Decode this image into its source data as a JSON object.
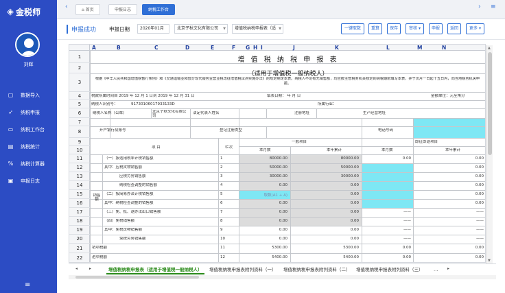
{
  "app": {
    "logo": "金税师",
    "user_name": "刘辉"
  },
  "sidebar": {
    "items": [
      {
        "label": "数据导入",
        "icon": "document-icon"
      },
      {
        "label": "纳税申报",
        "icon": "send-icon"
      },
      {
        "label": "纳税工作台",
        "icon": "monitor-icon"
      },
      {
        "label": "纳税统计",
        "icon": "report-icon"
      },
      {
        "label": "纳税计算器",
        "icon": "percent-icon"
      },
      {
        "label": "申报日志",
        "icon": "log-icon"
      }
    ],
    "menu_icon": "≡"
  },
  "tabs": [
    {
      "label": "首页",
      "active": false
    },
    {
      "label": "申报日志",
      "active": false
    },
    {
      "label": "纳税工作台",
      "active": true
    }
  ],
  "toolbar": {
    "status": "申报成功",
    "period_label": "申报日期",
    "period_value": "2020年01月",
    "company": "北京子秋文化有限公司",
    "form_type": "增值税纳税申报表（适",
    "buttons": [
      "一键取数",
      "重算",
      "保存",
      "审核",
      "申报",
      "返回",
      "更多"
    ]
  },
  "sheet": {
    "columns": [
      "A",
      "B",
      "C",
      "D",
      "E",
      "F",
      "G",
      "H",
      "I",
      "J",
      "K",
      "L",
      "M",
      "N"
    ],
    "rows": [
      "1",
      "2",
      "3",
      "4",
      "5",
      "6",
      "7",
      "8",
      "9",
      "10",
      "11",
      "12",
      "13",
      "14",
      "15",
      "16",
      "17",
      "18",
      "19",
      "20",
      "21",
      "22"
    ],
    "title": "增 值 税 纳 税 申 报 表",
    "subtitle": "（适用于增值税一般纳税人）",
    "note": "根据《中华人民共和国增值税暂行条例》和《交通运输业和部分现代服务业营业税改征增值税试点实施办法》的规定制定本表。纳税人不论有无销售额，均应按主管税务机关核定的纳税期限填写本表，并于次月一日起十五日内，向当地税务机关申报。",
    "period_line": "税款所属时间自  2019  年  12  月  1  日到  2019  年  12  月  31  日",
    "fill_date": "填表日期：    年    月    日",
    "unit": "金额单位：元至角分",
    "taxpayer_id_label": "纳税人识别号：",
    "taxpayer_id": "91730106017933133D",
    "industry_label": "所属行业：",
    "taxpayer_name_label": "纳税人名称（公章）",
    "taxpayer_name": "北京子秋文化有限公司",
    "legal_rep_label": "法定代表人姓名",
    "reg_addr_label": "注册地址",
    "biz_addr_label": "生产经营地址",
    "bank_label": "开户银行及账号",
    "reg_type_label": "登记注册类型",
    "phone_label": "电话号码",
    "item_header": "项    目",
    "line_header": "栏次",
    "general_header": "一般项目",
    "immediate_header": "即征即退项目",
    "this_month": "本月数",
    "year_total": "本年累计",
    "sales_group": "销售额",
    "line_items": [
      {
        "label": "（一）按适用税率计税销售额",
        "no": "1",
        "gm": "80000.00",
        "gy": "80000.00",
        "im": "0.00",
        "iy": "0.00"
      },
      {
        "label": "其中：应税货物销售额",
        "no": "2",
        "gm": "50000.00",
        "gy": "50000.00",
        "im": "",
        "iy": "0.00"
      },
      {
        "label": "应税劳务销售额",
        "no": "3",
        "gm": "30000.00",
        "gy": "30000.00",
        "im": "",
        "iy": "0.00"
      },
      {
        "label": "纳税检查调整的销售额",
        "no": "4",
        "gm": "0.00",
        "gy": "0.00",
        "im": "",
        "iy": "0.00"
      },
      {
        "label": "（二）按简易办法计税销售额",
        "no": "5",
        "gm": "取数(A1 + A)",
        "gy": "0.00",
        "im": "",
        "iy": "0.00"
      },
      {
        "label": "其中：纳税检查调整的销售额",
        "no": "6",
        "gm": "0.00",
        "gy": "0.00",
        "im": "",
        "iy": "0.00"
      },
      {
        "label": "（三）免、抵、退办法出口销售额",
        "no": "7",
        "gm": "0.00",
        "gy": "0.00",
        "im": "——",
        "iy": "——"
      },
      {
        "label": "（四）免税销售额",
        "no": "8",
        "gm": "0.00",
        "gy": "0.00",
        "im": "——",
        "iy": "——"
      },
      {
        "label": "其中：免税货物销售额",
        "no": "9",
        "gm": "0.00",
        "gy": "0.00",
        "im": "——",
        "iy": "——"
      },
      {
        "label": "免税劳务销售额",
        "no": "10",
        "gm": "0.00",
        "gy": "0.00",
        "im": "——",
        "iy": "——"
      },
      {
        "label": "销项税额",
        "no": "11",
        "gm": "5300.00",
        "gy": "5300.00",
        "im": "0.00",
        "iy": "0.00"
      },
      {
        "label": "进项税额",
        "no": "12",
        "gm": "5400.00",
        "gy": "5400.00",
        "im": "0.00",
        "iy": "0.00"
      }
    ]
  },
  "sheet_tabs": [
    {
      "label": "增值税纳税申报表（适用于增值税一般纳税人）",
      "active": true
    },
    {
      "label": "增值税纳税申报表附列资料（一）",
      "active": false
    },
    {
      "label": "增值税纳税申报表附列资料（二）",
      "active": false
    },
    {
      "label": "增值税纳税申报表附列资料（三）",
      "active": false
    }
  ],
  "sheet_tabs_more": "…"
}
